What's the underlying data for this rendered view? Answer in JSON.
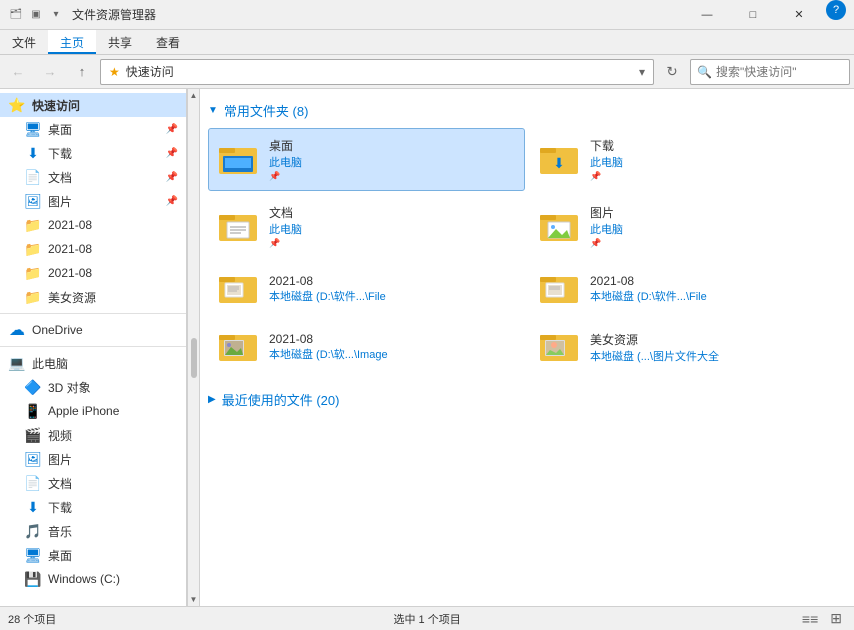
{
  "titleBar": {
    "title": "文件资源管理器",
    "controls": [
      "—",
      "□",
      "✕"
    ]
  },
  "ribbon": {
    "tabs": [
      "文件",
      "主页",
      "共享",
      "查看"
    ],
    "activeTab": "主页"
  },
  "addressBar": {
    "back": "←",
    "forward": "→",
    "up": "↑",
    "star": "★",
    "path": "快速访问",
    "refresh": "↻",
    "searchPlaceholder": "搜索\"快速访问\""
  },
  "sidebar": {
    "items": [
      {
        "id": "quick-access",
        "label": "快速访问",
        "icon": "⭐",
        "type": "header",
        "active": true
      },
      {
        "id": "desktop",
        "label": "桌面",
        "icon": "🖥",
        "type": "item",
        "pinned": true,
        "indent": 2
      },
      {
        "id": "downloads",
        "label": "下载",
        "icon": "📥",
        "type": "item",
        "pinned": true,
        "indent": 2
      },
      {
        "id": "documents",
        "label": "文档",
        "icon": "📄",
        "type": "item",
        "pinned": true,
        "indent": 2
      },
      {
        "id": "pictures",
        "label": "图片",
        "icon": "🖼",
        "type": "item",
        "pinned": true,
        "indent": 2
      },
      {
        "id": "folder1",
        "label": "2021-08",
        "icon": "📁",
        "type": "item",
        "indent": 2
      },
      {
        "id": "folder2",
        "label": "2021-08",
        "icon": "📁",
        "type": "item",
        "indent": 2
      },
      {
        "id": "folder3",
        "label": "2021-08",
        "icon": "📁",
        "type": "item",
        "indent": 2
      },
      {
        "id": "folder4",
        "label": "美女资源",
        "icon": "📁",
        "type": "item",
        "indent": 2
      },
      {
        "id": "onedrive",
        "label": "OneDrive",
        "icon": "☁",
        "type": "section-header"
      },
      {
        "id": "this-pc",
        "label": "此电脑",
        "icon": "💻",
        "type": "section-header"
      },
      {
        "id": "3d-objects",
        "label": "3D 对象",
        "icon": "🔷",
        "type": "item",
        "indent": 2
      },
      {
        "id": "apple-iphone",
        "label": "Apple iPhone",
        "icon": "📱",
        "type": "item",
        "indent": 2
      },
      {
        "id": "videos",
        "label": "视频",
        "icon": "🎬",
        "type": "item",
        "indent": 2
      },
      {
        "id": "pictures2",
        "label": "图片",
        "icon": "🖼",
        "type": "item",
        "indent": 2
      },
      {
        "id": "documents2",
        "label": "文档",
        "icon": "📄",
        "type": "item",
        "indent": 2
      },
      {
        "id": "downloads2",
        "label": "下载",
        "icon": "📥",
        "type": "item",
        "indent": 2
      },
      {
        "id": "music",
        "label": "音乐",
        "icon": "🎵",
        "type": "item",
        "indent": 2
      },
      {
        "id": "desktop2",
        "label": "桌面",
        "icon": "🖥",
        "type": "item",
        "indent": 2
      },
      {
        "id": "windows-c",
        "label": "Windows (C:)",
        "icon": "💾",
        "type": "item",
        "indent": 2
      }
    ]
  },
  "content": {
    "sections": [
      {
        "id": "frequent",
        "title": "常用文件夹 (8)",
        "expanded": true,
        "folders": [
          {
            "id": "f1",
            "name": "桌面",
            "sub": "此电脑",
            "pinned": true,
            "selected": true,
            "type": "desktop"
          },
          {
            "id": "f2",
            "name": "下载",
            "sub": "此电脑",
            "pinned": true,
            "selected": false,
            "type": "download"
          },
          {
            "id": "f3",
            "name": "文档",
            "sub": "此电脑",
            "pinned": true,
            "selected": false,
            "type": "doc"
          },
          {
            "id": "f4",
            "name": "图片",
            "sub": "此电脑",
            "pinned": true,
            "selected": false,
            "type": "pic"
          },
          {
            "id": "f5",
            "name": "2021-08",
            "sub": "本地磁盘 (D:\\软件...\\File",
            "pinned": false,
            "selected": false,
            "type": "folder"
          },
          {
            "id": "f6",
            "name": "2021-08",
            "sub": "本地磁盘 (D:\\软件...\\File",
            "pinned": false,
            "selected": false,
            "type": "folder"
          },
          {
            "id": "f7",
            "name": "2021-08",
            "sub": "本地磁盘 (D:\\软...\\Image",
            "pinned": false,
            "selected": false,
            "type": "folder-img"
          },
          {
            "id": "f8",
            "name": "美女资源",
            "sub": "本地磁盘 (...\\图片文件大全",
            "pinned": false,
            "selected": false,
            "type": "folder-img2"
          }
        ]
      },
      {
        "id": "recent",
        "title": "最近使用的文件 (20)",
        "expanded": false,
        "folders": []
      }
    ]
  },
  "statusBar": {
    "left": "28 个项目",
    "middle": "选中 1 个项目",
    "viewIcons": [
      "≡≡",
      "⊞"
    ]
  }
}
